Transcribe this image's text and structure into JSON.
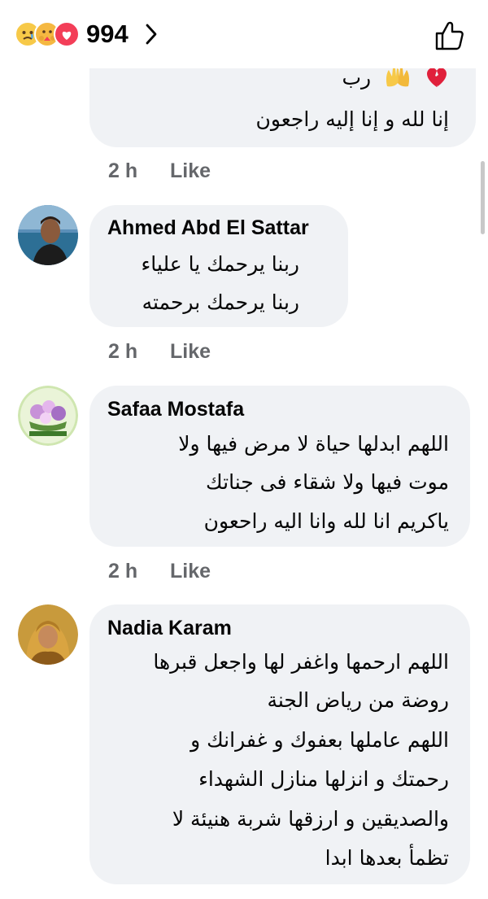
{
  "reactions_bar": {
    "count": "994",
    "reaction_icons": [
      "sad-reaction-icon",
      "care-reaction-icon",
      "love-reaction-icon"
    ]
  },
  "comments": [
    {
      "name": "",
      "lines": [
        "رب",
        "إنا لله و إنا إليه راجعون"
      ],
      "emojis": [
        "raising-hands-emoji",
        "broken-heart-emoji"
      ],
      "time": "2 h",
      "like_label": "Like"
    },
    {
      "name": "Ahmed Abd El Sattar",
      "lines": [
        "ربنا يرحمك يا علياء",
        "ربنا يرحمك برحمته"
      ],
      "time": "2 h",
      "like_label": "Like"
    },
    {
      "name": "Safaa Mostafa",
      "lines": [
        "اللهم ابدلها حياة لا مرض فيها ولا",
        "موت فيها ولا شقاء فى جناتك",
        "ياكريم انا لله وانا اليه راحعون"
      ],
      "time": "2 h",
      "like_label": "Like"
    },
    {
      "name": "Nadia Karam",
      "lines": [
        "اللهم ارحمها واغفر لها واجعل قبرها",
        "روضة من رياض الجنة",
        "اللهم عاملها بعفوك و غفرانك و",
        "رحمتك و انزلها منازل الشهداء",
        "والصديقين و ارزقها شربة هنيئة لا",
        "تظمأ بعدها ابدا"
      ]
    }
  ],
  "colors": {
    "bubble": "#f0f2f5",
    "meta_text": "#65676b",
    "text": "#050505"
  }
}
